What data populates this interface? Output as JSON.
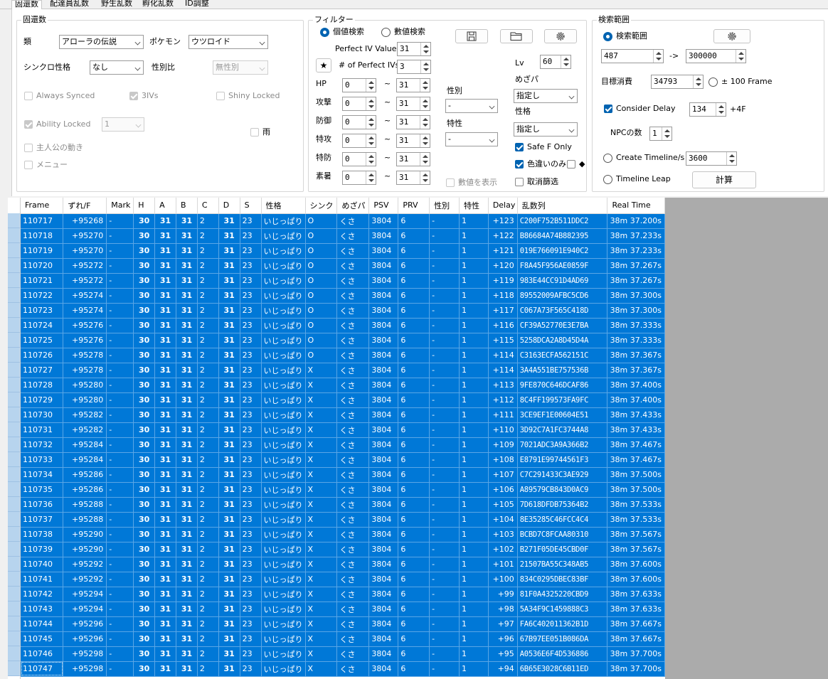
{
  "tabs": [
    "固還数",
    "配達員乱数",
    "野生乱数",
    "孵化乱数",
    "ID調整"
  ],
  "fixed": {
    "title": "固還数",
    "type_label": "類",
    "type_value": "アローラの伝説",
    "pokemon_label": "ポケモン",
    "pokemon_value": "ウツロイド",
    "sync_nature_label": "シンクロ性格",
    "sync_nature_value": "なし",
    "gender_ratio_label": "性別比",
    "gender_ratio_value": "無性別",
    "always_synced": "Always Synced",
    "three_ivs": "3IVs",
    "shiny_locked": "Shiny Locked",
    "ability_locked": "Ability Locked",
    "ability_value": "1",
    "rain": "雨",
    "player_movement": "主人公の動き",
    "menu": "メニュー"
  },
  "filter": {
    "title": "フィルター",
    "iv_search": "個値検索",
    "stat_search": "數値検索",
    "perfect_iv_label": "Perfect IV Value",
    "perfect_iv_value": "31",
    "star": "★",
    "num_perfect_label": "# of Perfect IVs",
    "num_perfect_value": "3",
    "stats": [
      {
        "label": "HP",
        "min": "0",
        "max": "31"
      },
      {
        "label": "攻撃",
        "min": "0",
        "max": "31"
      },
      {
        "label": "防御",
        "min": "0",
        "max": "31"
      },
      {
        "label": "特攻",
        "min": "0",
        "max": "31"
      },
      {
        "label": "特防",
        "min": "0",
        "max": "31"
      },
      {
        "label": "素暑",
        "min": "0",
        "max": "31"
      }
    ],
    "tilde": "~",
    "gender_label": "性別",
    "gender_value": "-",
    "ability_label": "特性",
    "ability_value": "-",
    "show_stats": "數値を表示",
    "lv_label": "Lv",
    "lv_value": "60",
    "hidden_power_label": "めざパ",
    "hidden_power_value": "指定し",
    "nature_label": "性格",
    "nature_value": "指定し",
    "safe_f_only": "Safe F Only",
    "shiny_only": "色違いのみ",
    "diamond": "◆",
    "cancel_filter": "取消篩选"
  },
  "search": {
    "title": "検索範囲",
    "range_label": "検索範囲",
    "start": "487",
    "arrow": "->",
    "end": "300000",
    "target_label": "目標消費",
    "target_value": "34793",
    "plus_minus": "± 100 Frame",
    "consider_delay": "Consider Delay",
    "delay_value": "134",
    "plus4f": "+4F",
    "npc_label": "NPCの数",
    "npc_value": "1",
    "create_timeline": "Create Timeline/s",
    "timeline_value": "3600",
    "timeline_leap": "Timeline Leap",
    "calc_button": "計算"
  },
  "table": {
    "columns": [
      "Frame",
      "ずれ/F",
      "Mark",
      "H",
      "A",
      "B",
      "C",
      "D",
      "S",
      "性格",
      "シンク",
      "めざパ",
      "PSV",
      "PRV",
      "性別",
      "特性",
      "Delay",
      "乱数列",
      "Real Time"
    ],
    "rows": [
      [
        "110717",
        "+95268",
        "-",
        "30",
        "31",
        "31",
        "2",
        "31",
        "23",
        "いじっぱり",
        "O",
        "くさ",
        "3804",
        "6",
        "-",
        "1",
        "+123",
        "C200F752B511DDC2",
        "38m 37.200s"
      ],
      [
        "110718",
        "+95270",
        "-",
        "30",
        "31",
        "31",
        "2",
        "31",
        "23",
        "いじっぱり",
        "O",
        "くさ",
        "3804",
        "6",
        "-",
        "1",
        "+122",
        "B86684A74B882395",
        "38m 37.233s"
      ],
      [
        "110719",
        "+95270",
        "-",
        "30",
        "31",
        "31",
        "2",
        "31",
        "23",
        "いじっぱり",
        "O",
        "くさ",
        "3804",
        "6",
        "-",
        "1",
        "+121",
        "019E766091E940C2",
        "38m 37.233s"
      ],
      [
        "110720",
        "+95272",
        "-",
        "30",
        "31",
        "31",
        "2",
        "31",
        "23",
        "いじっぱり",
        "O",
        "くさ",
        "3804",
        "6",
        "-",
        "1",
        "+120",
        "F8A45F956AE0859F",
        "38m 37.267s"
      ],
      [
        "110721",
        "+95272",
        "-",
        "30",
        "31",
        "31",
        "2",
        "31",
        "23",
        "いじっぱり",
        "O",
        "くさ",
        "3804",
        "6",
        "-",
        "1",
        "+119",
        "983E44CC91D4AD69",
        "38m 37.267s"
      ],
      [
        "110722",
        "+95274",
        "-",
        "30",
        "31",
        "31",
        "2",
        "31",
        "23",
        "いじっぱり",
        "O",
        "くさ",
        "3804",
        "6",
        "-",
        "1",
        "+118",
        "89552009AFBC5CD6",
        "38m 37.300s"
      ],
      [
        "110723",
        "+95274",
        "-",
        "30",
        "31",
        "31",
        "2",
        "31",
        "23",
        "いじっぱり",
        "O",
        "くさ",
        "3804",
        "6",
        "-",
        "1",
        "+117",
        "C067A73F565C418D",
        "38m 37.300s"
      ],
      [
        "110724",
        "+95276",
        "-",
        "30",
        "31",
        "31",
        "2",
        "31",
        "23",
        "いじっぱり",
        "O",
        "くさ",
        "3804",
        "6",
        "-",
        "1",
        "+116",
        "CF39A52770E3E7BA",
        "38m 37.333s"
      ],
      [
        "110725",
        "+95276",
        "-",
        "30",
        "31",
        "31",
        "2",
        "31",
        "23",
        "いじっぱり",
        "O",
        "くさ",
        "3804",
        "6",
        "-",
        "1",
        "+115",
        "5258DCA2A8D45D4A",
        "38m 37.333s"
      ],
      [
        "110726",
        "+95278",
        "-",
        "30",
        "31",
        "31",
        "2",
        "31",
        "23",
        "いじっぱり",
        "O",
        "くさ",
        "3804",
        "6",
        "-",
        "1",
        "+114",
        "C3163ECFA562151C",
        "38m 37.367s"
      ],
      [
        "110727",
        "+95278",
        "-",
        "30",
        "31",
        "31",
        "2",
        "31",
        "23",
        "いじっぱり",
        "X",
        "くさ",
        "3804",
        "6",
        "-",
        "1",
        "+114",
        "3A4A551BE757536B",
        "38m 37.367s"
      ],
      [
        "110728",
        "+95280",
        "-",
        "30",
        "31",
        "31",
        "2",
        "31",
        "23",
        "いじっぱり",
        "X",
        "くさ",
        "3804",
        "6",
        "-",
        "1",
        "+113",
        "9FE870C646DCAF86",
        "38m 37.400s"
      ],
      [
        "110729",
        "+95280",
        "-",
        "30",
        "31",
        "31",
        "2",
        "31",
        "23",
        "いじっぱり",
        "X",
        "くさ",
        "3804",
        "6",
        "-",
        "1",
        "+112",
        "8C4FF199573FA9FC",
        "38m 37.400s"
      ],
      [
        "110730",
        "+95282",
        "-",
        "30",
        "31",
        "31",
        "2",
        "31",
        "23",
        "いじっぱり",
        "X",
        "くさ",
        "3804",
        "6",
        "-",
        "1",
        "+111",
        "3CE9EF1E00604E51",
        "38m 37.433s"
      ],
      [
        "110731",
        "+95282",
        "-",
        "30",
        "31",
        "31",
        "2",
        "31",
        "23",
        "いじっぱり",
        "X",
        "くさ",
        "3804",
        "6",
        "-",
        "1",
        "+110",
        "3D92C7A1FC3744A8",
        "38m 37.433s"
      ],
      [
        "110732",
        "+95284",
        "-",
        "30",
        "31",
        "31",
        "2",
        "31",
        "23",
        "いじっぱり",
        "X",
        "くさ",
        "3804",
        "6",
        "-",
        "1",
        "+109",
        "7021ADC3A9A366B2",
        "38m 37.467s"
      ],
      [
        "110733",
        "+95284",
        "-",
        "30",
        "31",
        "31",
        "2",
        "31",
        "23",
        "いじっぱり",
        "X",
        "くさ",
        "3804",
        "6",
        "-",
        "1",
        "+108",
        "E8791E99744561F3",
        "38m 37.467s"
      ],
      [
        "110734",
        "+95286",
        "-",
        "30",
        "31",
        "31",
        "2",
        "31",
        "23",
        "いじっぱり",
        "X",
        "くさ",
        "3804",
        "6",
        "-",
        "1",
        "+107",
        "C7C291433C3AE929",
        "38m 37.500s"
      ],
      [
        "110735",
        "+95286",
        "-",
        "30",
        "31",
        "31",
        "2",
        "31",
        "23",
        "いじっぱり",
        "X",
        "くさ",
        "3804",
        "6",
        "-",
        "1",
        "+106",
        "A89579CB843D0AC9",
        "38m 37.500s"
      ],
      [
        "110736",
        "+95288",
        "-",
        "30",
        "31",
        "31",
        "2",
        "31",
        "23",
        "いじっぱり",
        "X",
        "くさ",
        "3804",
        "6",
        "-",
        "1",
        "+105",
        "7D618DFDB75364B2",
        "38m 37.533s"
      ],
      [
        "110737",
        "+95288",
        "-",
        "30",
        "31",
        "31",
        "2",
        "31",
        "23",
        "いじっぱり",
        "X",
        "くさ",
        "3804",
        "6",
        "-",
        "1",
        "+104",
        "8E35285C46FCC4C4",
        "38m 37.533s"
      ],
      [
        "110738",
        "+95290",
        "-",
        "30",
        "31",
        "31",
        "2",
        "31",
        "23",
        "いじっぱり",
        "X",
        "くさ",
        "3804",
        "6",
        "-",
        "1",
        "+103",
        "BCBD7C8FCAA80310",
        "38m 37.567s"
      ],
      [
        "110739",
        "+95290",
        "-",
        "30",
        "31",
        "31",
        "2",
        "31",
        "23",
        "いじっぱり",
        "X",
        "くさ",
        "3804",
        "6",
        "-",
        "1",
        "+102",
        "B271F05DE45CBD0F",
        "38m 37.567s"
      ],
      [
        "110740",
        "+95292",
        "-",
        "30",
        "31",
        "31",
        "2",
        "31",
        "23",
        "いじっぱり",
        "X",
        "くさ",
        "3804",
        "6",
        "-",
        "1",
        "+101",
        "21507BA55C348AB5",
        "38m 37.600s"
      ],
      [
        "110741",
        "+95292",
        "-",
        "30",
        "31",
        "31",
        "2",
        "31",
        "23",
        "いじっぱり",
        "X",
        "くさ",
        "3804",
        "6",
        "-",
        "1",
        "+100",
        "834C0295DBEC83BF",
        "38m 37.600s"
      ],
      [
        "110742",
        "+95294",
        "-",
        "30",
        "31",
        "31",
        "2",
        "31",
        "23",
        "いじっぱり",
        "X",
        "くさ",
        "3804",
        "6",
        "-",
        "1",
        "+99",
        "81F0A4325220CBD9",
        "38m 37.633s"
      ],
      [
        "110743",
        "+95294",
        "-",
        "30",
        "31",
        "31",
        "2",
        "31",
        "23",
        "いじっぱり",
        "X",
        "くさ",
        "3804",
        "6",
        "-",
        "1",
        "+98",
        "5A34F9C1459888C3",
        "38m 37.633s"
      ],
      [
        "110744",
        "+95296",
        "-",
        "30",
        "31",
        "31",
        "2",
        "31",
        "23",
        "いじっぱり",
        "X",
        "くさ",
        "3804",
        "6",
        "-",
        "1",
        "+97",
        "FA6C402011362B1D",
        "38m 37.667s"
      ],
      [
        "110745",
        "+95296",
        "-",
        "30",
        "31",
        "31",
        "2",
        "31",
        "23",
        "いじっぱり",
        "X",
        "くさ",
        "3804",
        "6",
        "-",
        "1",
        "+96",
        "67B97EE051B086DA",
        "38m 37.667s"
      ],
      [
        "110746",
        "+95298",
        "-",
        "30",
        "31",
        "31",
        "2",
        "31",
        "23",
        "いじっぱり",
        "X",
        "くさ",
        "3804",
        "6",
        "-",
        "1",
        "+95",
        "A0536E6F4D536886",
        "38m 37.700s"
      ],
      [
        "110747",
        "+95298",
        "-",
        "30",
        "31",
        "31",
        "2",
        "31",
        "23",
        "いじっぱり",
        "X",
        "くさ",
        "3804",
        "6",
        "-",
        "1",
        "+94",
        "6B65E3028C6B11ED",
        "38m 37.700s"
      ]
    ]
  },
  "icons": {
    "save": "floppy-disk-icon",
    "open": "folder-icon",
    "settings": "gear-icon"
  },
  "colors": {
    "selection": "#0078d7",
    "accent": "#0063b1",
    "grid_background": "#ababab"
  }
}
